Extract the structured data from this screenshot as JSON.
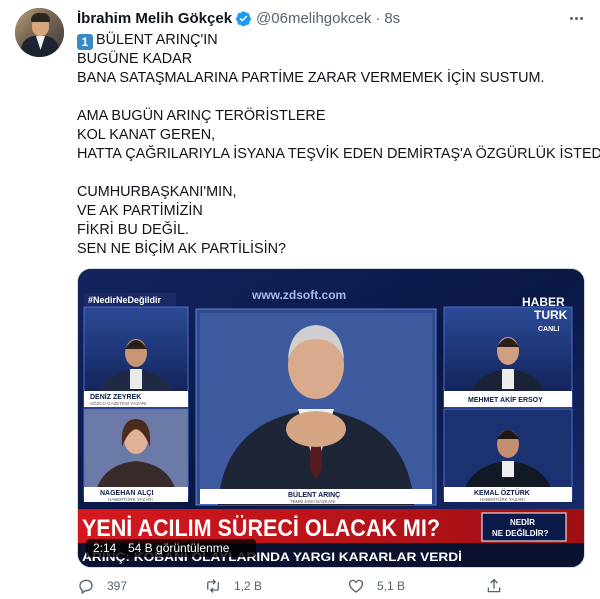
{
  "tweet": {
    "author_name": "İbrahim Melih Gökçek",
    "handle": "@06melihgokcek",
    "separator": "·",
    "time": "8s",
    "keycap": "1",
    "lines": [
      "BÜLENT ARINÇ'IN",
      "BUGÜNE KADAR",
      "BANA SATAŞMALARINA PARTİME ZARAR VERMEMEK İÇİN SUSTUM.",
      "",
      "AMA BUGÜN ARINÇ TERÖRİSTLERE",
      "KOL KANAT GEREN,",
      "HATTA ÇAĞRILARIYLA İSYANA TEŞVİK EDEN DEMİRTAŞ'A ÖZGÜRLÜK İSTEDİ.",
      "",
      "CUMHURBAŞKANI'MIN,",
      "VE AK PARTİMİZİN",
      "FİKRİ BU DEĞİL.",
      "SEN NE BİÇİM AK PARTİLİSİN?"
    ]
  },
  "video": {
    "hashtag": "#NedirNeDeğildir",
    "website": "www.zdsoft.com",
    "channel_top": "HABER",
    "channel_bottom": "TURK",
    "live_label": "CANLI",
    "guests": [
      {
        "name": "DENİZ ZEYREK",
        "role": "SÖZCÜ GAZETESİ YAZARI"
      },
      {
        "name": "MEHMET AKİF ERSOY",
        "role": ""
      },
      {
        "name": "NAGEHAN ALÇI",
        "role": "HABERTÜRK YAZARI"
      },
      {
        "name": "BÜLENT ARINÇ",
        "role": "TBMM ESKİ BAŞKANI"
      },
      {
        "name": "KEMAL ÖZTÜRK",
        "role": "HABERTÜRK YAZARI"
      }
    ],
    "headline": "YENİ ACILIM SÜRECİ OLACAK MI?",
    "show_line1": "NEDİR",
    "show_line2": "NE DEĞİLDİR?",
    "ticker": "ARINÇ: KOBANİ OLAYLARINDA YARGI KARARLAR VERDİ",
    "duration": "2:14",
    "views": "54 B görüntülenme"
  },
  "actions": {
    "reply_count": "397",
    "retweet_count": "1,2 B",
    "like_count": "5,1 B"
  },
  "colors": {
    "text": "#0f1419",
    "muted": "#536471",
    "verified": "#1d9bf0",
    "headline_red": "#c4161c",
    "studio_blue": "#0c1a4a"
  }
}
